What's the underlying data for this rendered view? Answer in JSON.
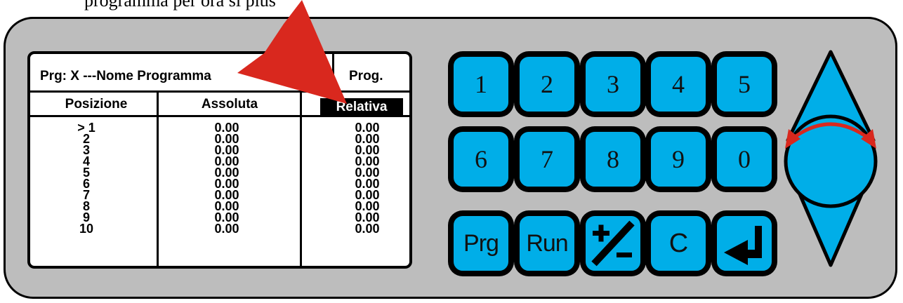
{
  "caption": "programma per ora si plus",
  "lcd": {
    "program_line": "Prg:  X    ---Nome Programma",
    "prog_label": "Prog.",
    "headers": [
      "Posizione",
      "Assoluta",
      "Relativa"
    ],
    "positions": [
      "> 1",
      "2",
      "3",
      "4",
      "5",
      "6",
      "7",
      "8",
      "9",
      "10"
    ],
    "assoluta": [
      "0.00",
      "0.00",
      "0.00",
      "0.00",
      "0.00",
      "0.00",
      "0.00",
      "0.00",
      "0.00",
      "0.00"
    ],
    "relativa": [
      "0.00",
      "0.00",
      "0.00",
      "0.00",
      "0.00",
      "0.00",
      "0.00",
      "0.00",
      "0.00",
      "0.00"
    ]
  },
  "keypad": {
    "row1": [
      "1",
      "2",
      "3",
      "4",
      "5"
    ],
    "row2": [
      "6",
      "7",
      "8",
      "9",
      "0"
    ],
    "prg": "Prg",
    "run": "Run",
    "clear": "C",
    "plusminus_icon": "plus-minus-icon",
    "enter_icon": "enter-arrow-icon"
  },
  "colors": {
    "panel": "#bdbdbd",
    "key": "#00aee8",
    "arrow": "#d9281e"
  }
}
